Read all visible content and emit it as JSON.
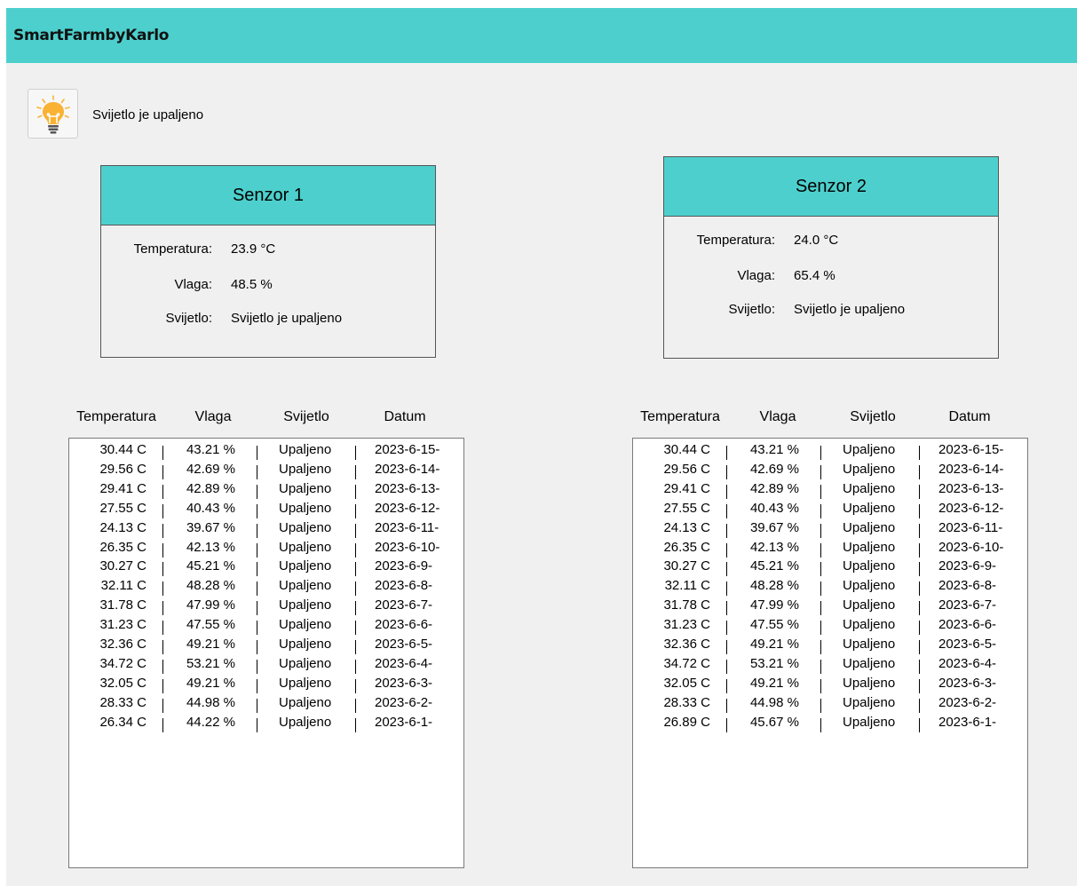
{
  "app": {
    "title": "SmartFarmbyKarlo"
  },
  "light": {
    "status_text": "Svijetlo je upaljeno",
    "icon": "lightbulb-icon"
  },
  "sensor_labels": {
    "temperature": "Temperatura:",
    "humidity": "Vlaga:",
    "light": "Svijetlo:"
  },
  "sensors": [
    {
      "title": "Senzor 1",
      "temperature": "23.9 °C",
      "humidity": "48.5 %",
      "light": "Svijetlo je upaljeno"
    },
    {
      "title": "Senzor 2",
      "temperature": "24.0 °C",
      "humidity": "65.4 %",
      "light": "Svijetlo je upaljeno"
    }
  ],
  "table_headers": [
    "Temperatura",
    "Vlaga",
    "Svijetlo",
    "Datum"
  ],
  "history": [
    [
      [
        "30.44 C",
        "43.21 %",
        "Upaljeno",
        "2023-6-15-"
      ],
      [
        "29.56 C",
        "42.69 %",
        "Upaljeno",
        "2023-6-14-"
      ],
      [
        "29.41 C",
        "42.89 %",
        "Upaljeno",
        "2023-6-13-"
      ],
      [
        "27.55 C",
        "40.43 %",
        "Upaljeno",
        "2023-6-12-"
      ],
      [
        "24.13 C",
        "39.67 %",
        "Upaljeno",
        "2023-6-11-"
      ],
      [
        "26.35 C",
        "42.13 %",
        "Upaljeno",
        "2023-6-10-"
      ],
      [
        "30.27 C",
        "45.21 %",
        "Upaljeno",
        "2023-6-9-"
      ],
      [
        "32.11 C",
        "48.28 %",
        "Upaljeno",
        "2023-6-8-"
      ],
      [
        "31.78 C",
        "47.99 %",
        "Upaljeno",
        "2023-6-7-"
      ],
      [
        "31.23 C",
        "47.55 %",
        "Upaljeno",
        "2023-6-6-"
      ],
      [
        "32.36 C",
        "49.21 %",
        "Upaljeno",
        "2023-6-5-"
      ],
      [
        "34.72 C",
        "53.21 %",
        "Upaljeno",
        "2023-6-4-"
      ],
      [
        "32.05 C",
        "49.21 %",
        "Upaljeno",
        "2023-6-3-"
      ],
      [
        "28.33 C",
        "44.98 %",
        "Upaljeno",
        "2023-6-2-"
      ],
      [
        "26.34 C",
        "44.22 %",
        "Upaljeno",
        "2023-6-1-"
      ]
    ],
    [
      [
        "30.44 C",
        "43.21 %",
        "Upaljeno",
        "2023-6-15-"
      ],
      [
        "29.56 C",
        "42.69 %",
        "Upaljeno",
        "2023-6-14-"
      ],
      [
        "29.41 C",
        "42.89 %",
        "Upaljeno",
        "2023-6-13-"
      ],
      [
        "27.55 C",
        "40.43 %",
        "Upaljeno",
        "2023-6-12-"
      ],
      [
        "24.13 C",
        "39.67 %",
        "Upaljeno",
        "2023-6-11-"
      ],
      [
        "26.35 C",
        "42.13 %",
        "Upaljeno",
        "2023-6-10-"
      ],
      [
        "30.27 C",
        "45.21 %",
        "Upaljeno",
        "2023-6-9-"
      ],
      [
        "32.11 C",
        "48.28 %",
        "Upaljeno",
        "2023-6-8-"
      ],
      [
        "31.78 C",
        "47.99 %",
        "Upaljeno",
        "2023-6-7-"
      ],
      [
        "31.23 C",
        "47.55 %",
        "Upaljeno",
        "2023-6-6-"
      ],
      [
        "32.36 C",
        "49.21 %",
        "Upaljeno",
        "2023-6-5-"
      ],
      [
        "34.72 C",
        "53.21 %",
        "Upaljeno",
        "2023-6-4-"
      ],
      [
        "32.05 C",
        "49.21 %",
        "Upaljeno",
        "2023-6-3-"
      ],
      [
        "28.33 C",
        "44.98 %",
        "Upaljeno",
        "2023-6-2-"
      ],
      [
        "26.89 C",
        "45.67 %",
        "Upaljeno",
        "2023-6-1-"
      ]
    ]
  ],
  "colors": {
    "accent": "#4dd0cd",
    "background": "#f0f0f0",
    "bulb": "#f9b233"
  }
}
